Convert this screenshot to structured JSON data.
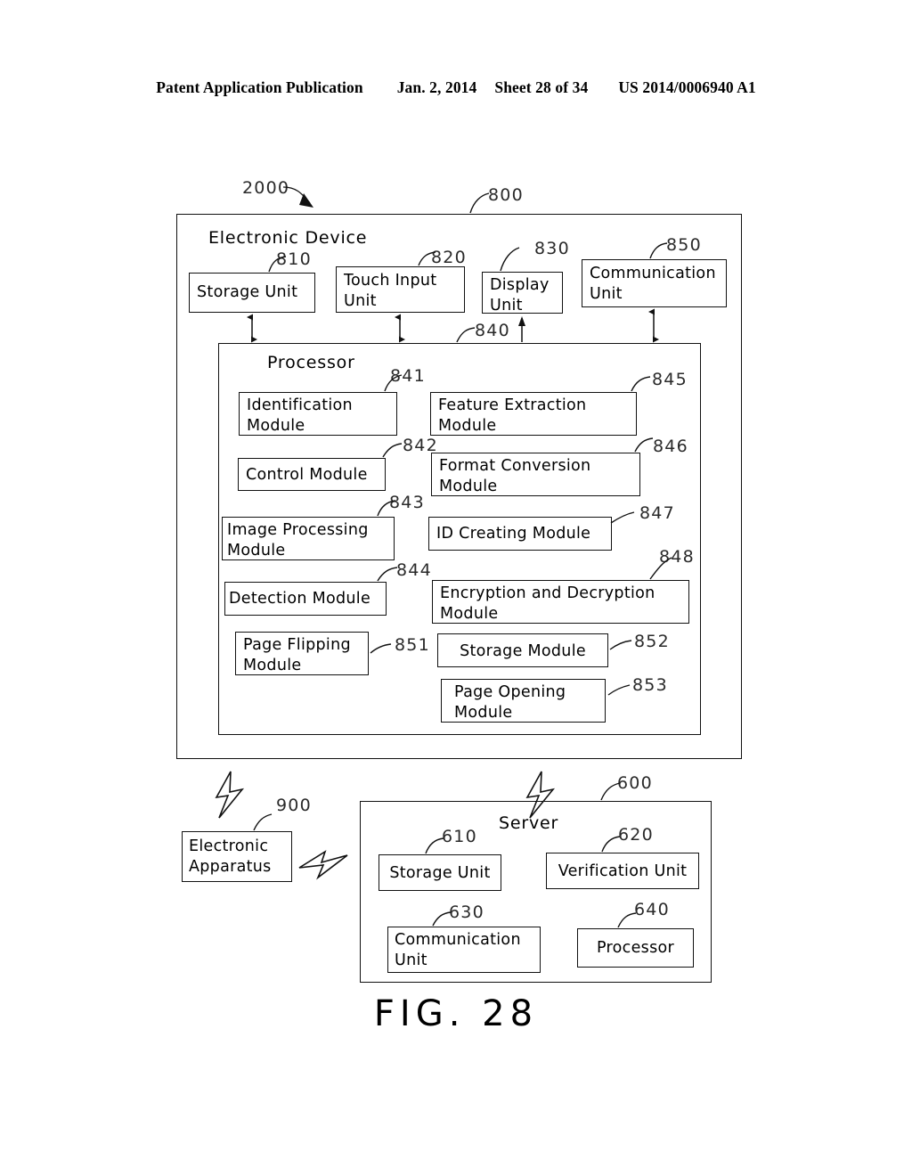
{
  "header": {
    "publication": "Patent Application Publication",
    "date": "Jan. 2, 2014",
    "sheet": "Sheet 28 of 34",
    "number": "US 2014/0006940 A1"
  },
  "figure": {
    "caption": "FIG. 28",
    "system_ref": "2000"
  },
  "electronic_device": {
    "title": "Electronic Device",
    "ref": "800",
    "units": [
      {
        "label": "Storage Unit",
        "ref": "810"
      },
      {
        "label": "Touch Input\nUnit",
        "ref": "820"
      },
      {
        "label": "Display\nUnit",
        "ref": "830"
      },
      {
        "label": "Communication\nUnit",
        "ref": "850"
      }
    ]
  },
  "processor": {
    "title": "Processor",
    "ref": "840",
    "modules_left": [
      {
        "label": "Identification\nModule",
        "ref": "841"
      },
      {
        "label": "Control  Module",
        "ref": "842"
      },
      {
        "label": "Image Processing\nModule",
        "ref": "843"
      },
      {
        "label": "Detection  Module",
        "ref": "844"
      },
      {
        "label": "Page  Flipping\nModule",
        "ref": "851"
      }
    ],
    "modules_right": [
      {
        "label": "Feature  Extraction\nModule",
        "ref": "845"
      },
      {
        "label": "Format  Conversion\nModule",
        "ref": "846"
      },
      {
        "label": "ID  Creating  Module",
        "ref": "847"
      },
      {
        "label": "Encryption  and  Decryption\nModule",
        "ref": "848"
      },
      {
        "label": "Storage  Module",
        "ref": "852"
      },
      {
        "label": "Page  Opening\nModule",
        "ref": "853"
      }
    ]
  },
  "electronic_apparatus": {
    "label": "Electronic\nApparatus",
    "ref": "900"
  },
  "server": {
    "title": "Server",
    "ref": "600",
    "units": [
      {
        "label": "Storage  Unit",
        "ref": "610"
      },
      {
        "label": "Verification  Unit",
        "ref": "620"
      },
      {
        "label": "Communication\nUnit",
        "ref": "630"
      },
      {
        "label": "Processor",
        "ref": "640"
      }
    ]
  },
  "colors": {
    "line": "#111111",
    "text": "#000000",
    "refnum": "#2a2a2a",
    "background": "#ffffff"
  }
}
